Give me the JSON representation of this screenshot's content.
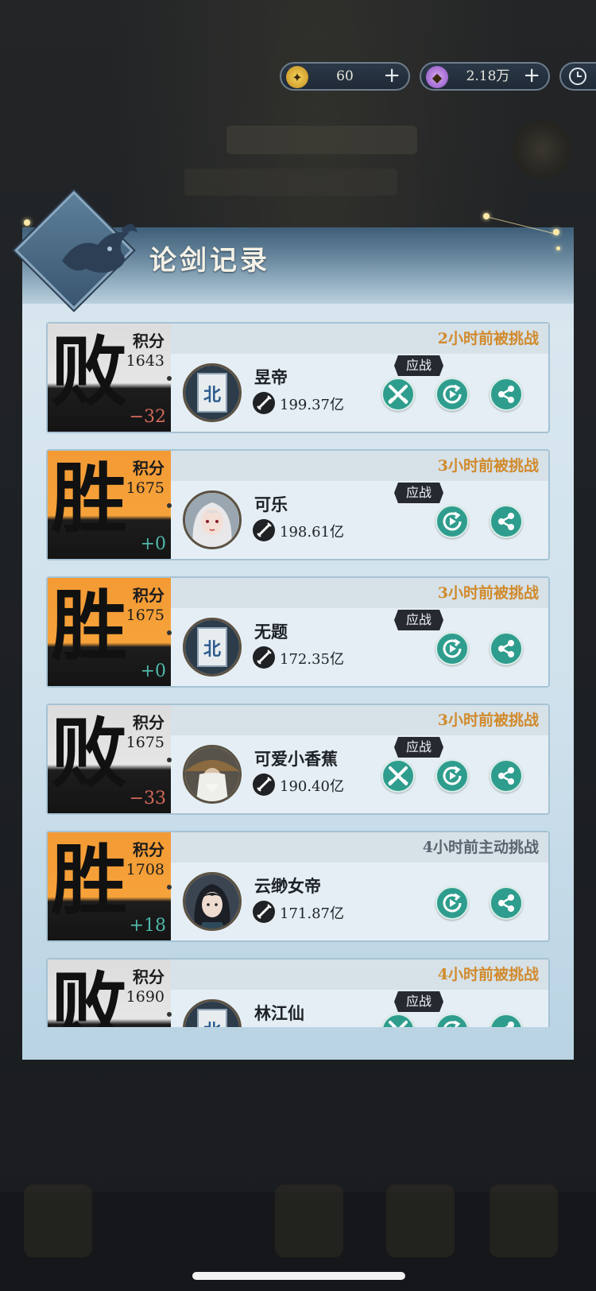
{
  "currency": [
    {
      "name": "gold-coin-icon",
      "value": "60"
    },
    {
      "name": "purple-crystal-icon",
      "value": "2.18万"
    }
  ],
  "panel": {
    "title": "论剑记录"
  },
  "records": [
    {
      "result": "败",
      "outcome": "loss",
      "score_label": "积分",
      "score": "1643",
      "delta": "−32",
      "delta_sign": "neg",
      "time": "2小时前被挑战",
      "time_style": "orange",
      "name": "昱帝",
      "power": "199.37亿",
      "accept": "应战",
      "has_fight_button": true,
      "avatar": "banner-avatar"
    },
    {
      "result": "胜",
      "outcome": "win",
      "score_label": "积分",
      "score": "1675",
      "delta": "+0",
      "delta_sign": "pos",
      "time": "3小时前被挑战",
      "time_style": "orange",
      "name": "可乐",
      "power": "198.61亿",
      "accept": "应战",
      "has_fight_button": false,
      "avatar": "silver-hair-avatar"
    },
    {
      "result": "胜",
      "outcome": "win",
      "score_label": "积分",
      "score": "1675",
      "delta": "+0",
      "delta_sign": "pos",
      "time": "3小时前被挑战",
      "time_style": "orange",
      "name": "无题",
      "power": "172.35亿",
      "accept": "应战",
      "has_fight_button": false,
      "avatar": "banner-avatar"
    },
    {
      "result": "败",
      "outcome": "loss",
      "score_label": "积分",
      "score": "1675",
      "delta": "−33",
      "delta_sign": "neg",
      "time": "3小时前被挑战",
      "time_style": "orange",
      "name": "可爱小香蕉",
      "power": "190.40亿",
      "accept": "应战",
      "has_fight_button": true,
      "avatar": "straw-hat-elder-avatar"
    },
    {
      "result": "胜",
      "outcome": "win",
      "score_label": "积分",
      "score": "1708",
      "delta": "+18",
      "delta_sign": "pos",
      "time": "4小时前主动挑战",
      "time_style": "gray",
      "name": "云缈女帝",
      "power": "171.87亿",
      "accept": "",
      "has_fight_button": false,
      "avatar": "dark-hair-avatar"
    },
    {
      "result": "败",
      "outcome": "loss",
      "score_label": "积分",
      "score": "1690",
      "delta": "",
      "delta_sign": "neg",
      "time": "4小时前被挑战",
      "time_style": "orange",
      "name": "林江仙",
      "power": "",
      "accept": "应战",
      "has_fight_button": true,
      "avatar": "banner-avatar"
    }
  ],
  "colors": {
    "win": "#f39a34",
    "loss_bg": "#dcdcdc",
    "button": "#2f9d8e",
    "time_orange": "#d18a2c"
  },
  "buttons": {
    "fight_icon": "crossed-swords-icon",
    "replay_icon": "replay-icon",
    "share_icon": "share-icon"
  }
}
